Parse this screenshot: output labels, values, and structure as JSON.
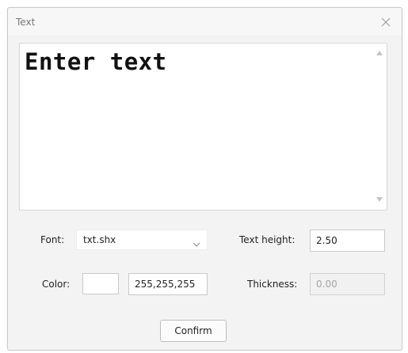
{
  "window": {
    "title": "Text",
    "close_icon": "close-icon"
  },
  "text_area": {
    "value": "Enter text",
    "scroll_up_icon": "triangle-up-icon",
    "scroll_down_icon": "triangle-down-icon"
  },
  "font": {
    "label": "Font:",
    "value": "txt.shx",
    "dropdown_icon": "chevron-down-icon"
  },
  "text_height": {
    "label": "Text height:",
    "value": "2.50"
  },
  "color": {
    "label": "Color:",
    "swatch": "#ffffff",
    "value": "255,255,255"
  },
  "thickness": {
    "label": "Thickness:",
    "value": "0.00"
  },
  "confirm_label": "Confirm"
}
